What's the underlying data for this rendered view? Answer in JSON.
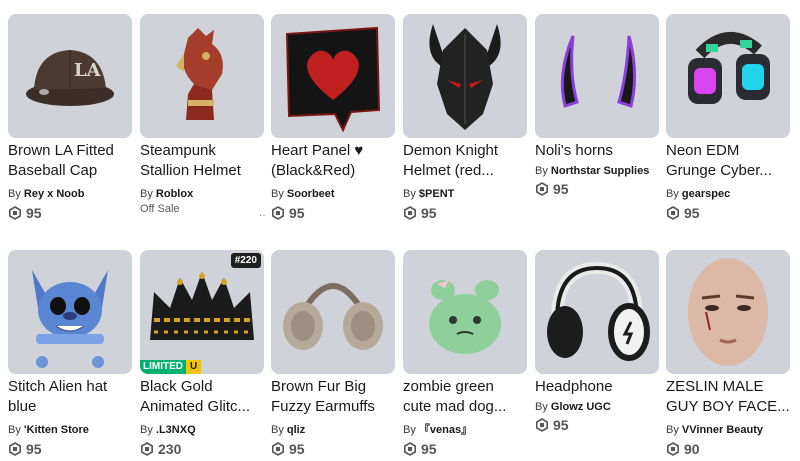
{
  "items": [
    {
      "name1": "Brown LA Fitted",
      "name2": "Baseball Cap",
      "by": "By",
      "creator": "Rey x Noob",
      "price": "95"
    },
    {
      "name1": "Steampunk",
      "name2": "Stallion Helmet",
      "by": "By",
      "creator": "Roblox",
      "status": "Off Sale",
      "dots": "··"
    },
    {
      "name1": "Heart Panel ♥",
      "name2": "(Black&Red)",
      "by": "By",
      "creator": "Soorbeet",
      "price": "95"
    },
    {
      "name1": "Demon Knight",
      "name2": "Helmet (red...",
      "by": "By",
      "creator": "$PENT",
      "price": "95"
    },
    {
      "name1": "Noli's horns",
      "name2": "",
      "by": "By",
      "creator": "Northstar Supplies",
      "price": "95"
    },
    {
      "name1": "Neon EDM",
      "name2": "Grunge Cyber...",
      "by": "By",
      "creator": "gearspec",
      "price": "95"
    },
    {
      "name1": "Stitch Alien hat",
      "name2": "blue",
      "by": "By",
      "creator": "'Kitten Store",
      "price": "95"
    },
    {
      "name1": "Black Gold",
      "name2": "Animated Glitc...",
      "by": "By",
      "creator": ".L3NXQ",
      "price": "230",
      "serial": "#220",
      "limited": "LIMITED",
      "limited_u": "U"
    },
    {
      "name1": "Brown Fur Big",
      "name2": "Fuzzy Earmuffs",
      "by": "By",
      "creator": "qliz",
      "price": "95"
    },
    {
      "name1": "zombie green",
      "name2": "cute mad dog...",
      "by": "By",
      "creator": "『venas』",
      "price": "95"
    },
    {
      "name1": "Headphone",
      "name2": "",
      "by": "By",
      "creator": "Glowz UGC",
      "price": "95"
    },
    {
      "name1": "ZESLIN MALE",
      "name2": "GUY BOY FACE...",
      "by": "By",
      "creator": "VVinner Beauty",
      "price": "90"
    }
  ],
  "colors": {
    "thumb_bg": "#cfd2d8",
    "limited": "#00b06f",
    "unique": "#f2c500"
  },
  "icons": {
    "currency": "robux-icon"
  }
}
